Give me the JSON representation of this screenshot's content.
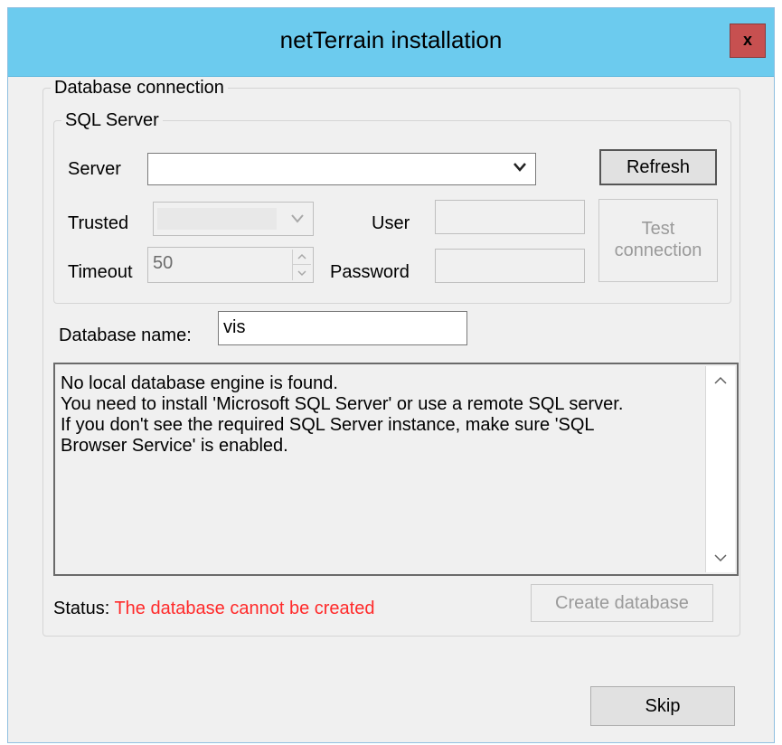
{
  "window": {
    "title": "netTerrain installation",
    "close_label": "x"
  },
  "db_group": {
    "legend": "Database connection",
    "sql_group": {
      "legend": "SQL Server",
      "server_label": "Server",
      "server_value": "",
      "refresh_label": "Refresh",
      "trusted_label": "Trusted",
      "trusted_value": "",
      "user_label": "User",
      "user_value": "",
      "timeout_label": "Timeout",
      "timeout_value": "50",
      "password_label": "Password",
      "password_value": "",
      "test_connection_label": "Test\nconnection"
    },
    "dbname_label": "Database name:",
    "dbname_value": "vis",
    "message": "No local database engine is found.\nYou need to install 'Microsoft SQL Server' or use a remote SQL server.\nIf you don't see the required SQL Server instance, make sure 'SQL\nBrowser Service' is enabled.",
    "status_label": "Status:",
    "status_value": "The database cannot be created",
    "create_db_label": "Create database"
  },
  "footer": {
    "skip_label": "Skip"
  },
  "colors": {
    "titlebar": "#6ccbee",
    "close": "#c75050",
    "status_error": "#ff2a2a"
  }
}
